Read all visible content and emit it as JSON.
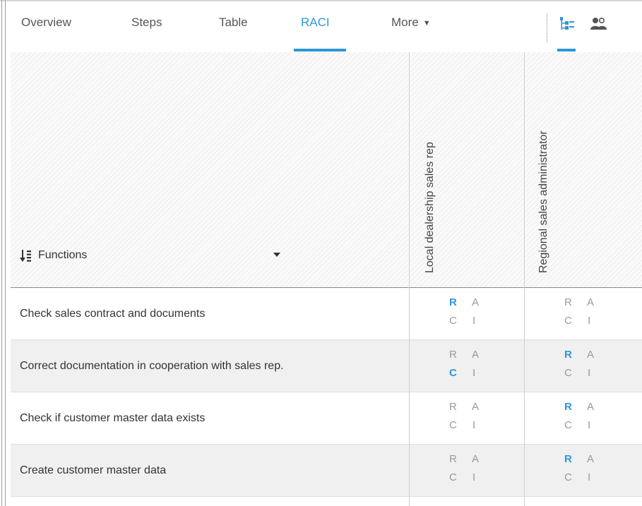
{
  "tabs": {
    "overview": "Overview",
    "steps": "Steps",
    "table": "Table",
    "raci": "RACI",
    "more": "More"
  },
  "view_icons": [
    "hierarchy-view-icon",
    "people-view-icon"
  ],
  "header": {
    "functions_label": "Functions",
    "roles": [
      "Local dealership sales rep",
      "Regional sales administrator"
    ]
  },
  "raci_letters": {
    "r": "R",
    "a": "A",
    "c": "C",
    "i": "I"
  },
  "rows": [
    {
      "label": "Check sales contract and documents",
      "role1": "R",
      "role2": ""
    },
    {
      "label": "Correct documentation in cooperation with sales rep.",
      "role1": "C",
      "role2": "R"
    },
    {
      "label": "Check if customer master data exists",
      "role1": "",
      "role2": "R"
    },
    {
      "label": "Create customer master data",
      "role1": "",
      "role2": "R"
    }
  ],
  "colors": {
    "accent": "#2f96d8",
    "inactive_letter": "#9a9a9a",
    "alt_row": "#f0f0f0"
  }
}
